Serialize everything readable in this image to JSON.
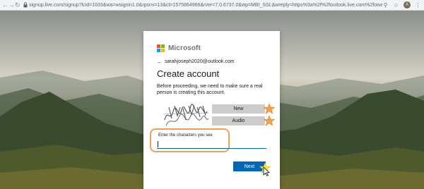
{
  "browser": {
    "url": "signup.live.com/signup?lcid=1033&wa=wsignin1.0&rpsnv=13&ct=1575864966&rver=7.0.6737.0&wp=MBI_SSL&wreply=https%3a%2f%2foutlook.live.com%2fowa%2f%3fnl...",
    "nav_back_icon": "arrow-left-icon",
    "nav_forward_icon": "arrow-right-icon",
    "nav_reload_icon": "reload-icon",
    "lock_icon": "lock-icon",
    "profile_initial": "A"
  },
  "card": {
    "brand": "Microsoft",
    "brand_colors": [
      "#f25022",
      "#7fba00",
      "#00a4ef",
      "#ffb900"
    ],
    "email": "sarahjoseph2020@outlook.com",
    "title": "Create account",
    "description": "Before proceeding, we need to make sure a real person is creating this account.",
    "captcha_buttons": {
      "new_label": "New",
      "audio_label": "Audio"
    },
    "input_label": "Enter the characters you see",
    "input_value": "",
    "next_label": "Next",
    "accent_color": "#0067b8",
    "highlight_color": "#f0a055"
  }
}
